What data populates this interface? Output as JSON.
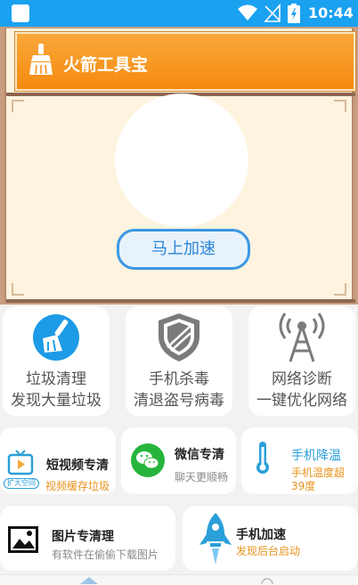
{
  "status_bar": {
    "time": "10:44",
    "icons": [
      "app-square-icon",
      "wifi-icon",
      "no-signal-icon",
      "battery-charging-icon"
    ]
  },
  "header": {
    "title": "火箭工具宝",
    "icon": "broom-icon",
    "accelerate_button": "马上加速"
  },
  "big_tools": [
    {
      "line1": "垃圾清理",
      "line2": "发现大量垃圾",
      "icon": "broom-circle-icon"
    },
    {
      "line1": "手机杀毒",
      "line2": "清退盗号病毒",
      "icon": "shield-icon"
    },
    {
      "line1": "网络诊断",
      "line2": "一键优化网络",
      "icon": "signal-tower-icon"
    }
  ],
  "mid_tools": [
    {
      "title": "短视频专清",
      "subtitle": "视频缓存垃圾",
      "badge": "扩大空间",
      "icon": "tv-play-icon"
    },
    {
      "title": "微信专清",
      "subtitle": "聊天更顺畅",
      "icon": "wechat-icon"
    },
    {
      "title": "手机降温",
      "subtitle_line1": "手机温度超",
      "subtitle_line2": "39度",
      "icon": "thermometer-icon"
    }
  ],
  "bottom_tools": [
    {
      "title": "图片专清理",
      "subtitle": "有软件在偷偷下载图片",
      "icon": "image-icon"
    },
    {
      "title": "手机加速",
      "subtitle": "发现后台启动",
      "icon": "rocket-icon"
    }
  ],
  "colors": {
    "status_bar": "#1aa1f0",
    "title_bar": "#f79a22",
    "accent_blue": "#2b86d8",
    "orange_text": "#e8931a"
  }
}
